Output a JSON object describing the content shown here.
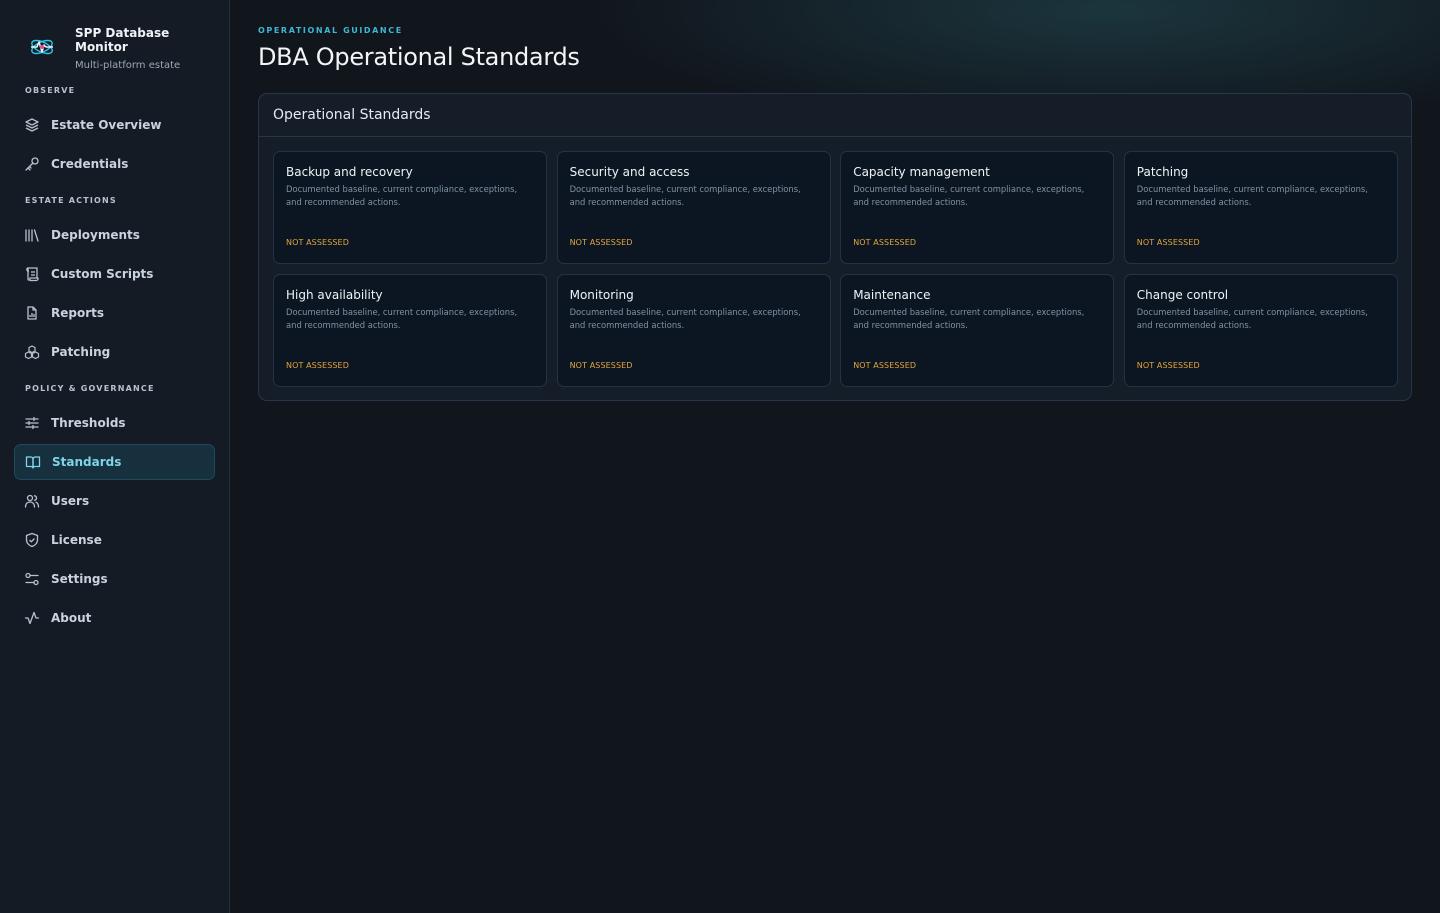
{
  "brand": {
    "title": "SPP Database Monitor",
    "subtitle": "Multi-platform estate"
  },
  "sidebar": {
    "sections": [
      {
        "label": "OBSERVE",
        "items": [
          {
            "label": "Estate Overview",
            "icon": "layers-icon"
          },
          {
            "label": "Credentials",
            "icon": "key-icon"
          }
        ]
      },
      {
        "label": "ESTATE ACTIONS",
        "items": [
          {
            "label": "Deployments",
            "icon": "library-icon"
          },
          {
            "label": "Custom Scripts",
            "icon": "scroll-icon"
          },
          {
            "label": "Reports",
            "icon": "file-chart-icon"
          },
          {
            "label": "Patching",
            "icon": "boxes-icon"
          }
        ]
      },
      {
        "label": "POLICY & GOVERNANCE",
        "items": [
          {
            "label": "Thresholds",
            "icon": "sliders-icon"
          },
          {
            "label": "Standards",
            "icon": "book-open-icon",
            "active": true
          },
          {
            "label": "Users",
            "icon": "users-icon"
          },
          {
            "label": "License",
            "icon": "shield-check-icon"
          },
          {
            "label": "Settings",
            "icon": "settings-toggles-icon"
          },
          {
            "label": "About",
            "icon": "activity-icon"
          }
        ]
      }
    ]
  },
  "header": {
    "eyebrow": "OPERATIONAL GUIDANCE",
    "title": "DBA Operational Standards"
  },
  "panel": {
    "title": "Operational Standards",
    "cards": [
      {
        "title": "Backup and recovery",
        "description": "Documented baseline, current compliance, exceptions, and recommended actions.",
        "status": "NOT ASSESSED"
      },
      {
        "title": "Security and access",
        "description": "Documented baseline, current compliance, exceptions, and recommended actions.",
        "status": "NOT ASSESSED"
      },
      {
        "title": "Capacity management",
        "description": "Documented baseline, current compliance, exceptions, and recommended actions.",
        "status": "NOT ASSESSED"
      },
      {
        "title": "Patching",
        "description": "Documented baseline, current compliance, exceptions, and recommended actions.",
        "status": "NOT ASSESSED"
      },
      {
        "title": "High availability",
        "description": "Documented baseline, current compliance, exceptions, and recommended actions.",
        "status": "NOT ASSESSED"
      },
      {
        "title": "Monitoring",
        "description": "Documented baseline, current compliance, exceptions, and recommended actions.",
        "status": "NOT ASSESSED"
      },
      {
        "title": "Maintenance",
        "description": "Documented baseline, current compliance, exceptions, and recommended actions.",
        "status": "NOT ASSESSED"
      },
      {
        "title": "Change control",
        "description": "Documented baseline, current compliance, exceptions, and recommended actions.",
        "status": "NOT ASSESSED"
      }
    ]
  },
  "colors": {
    "accent": "#3fb6d6",
    "active_text": "#7fd4ea",
    "status_warning": "#e3a53a"
  }
}
